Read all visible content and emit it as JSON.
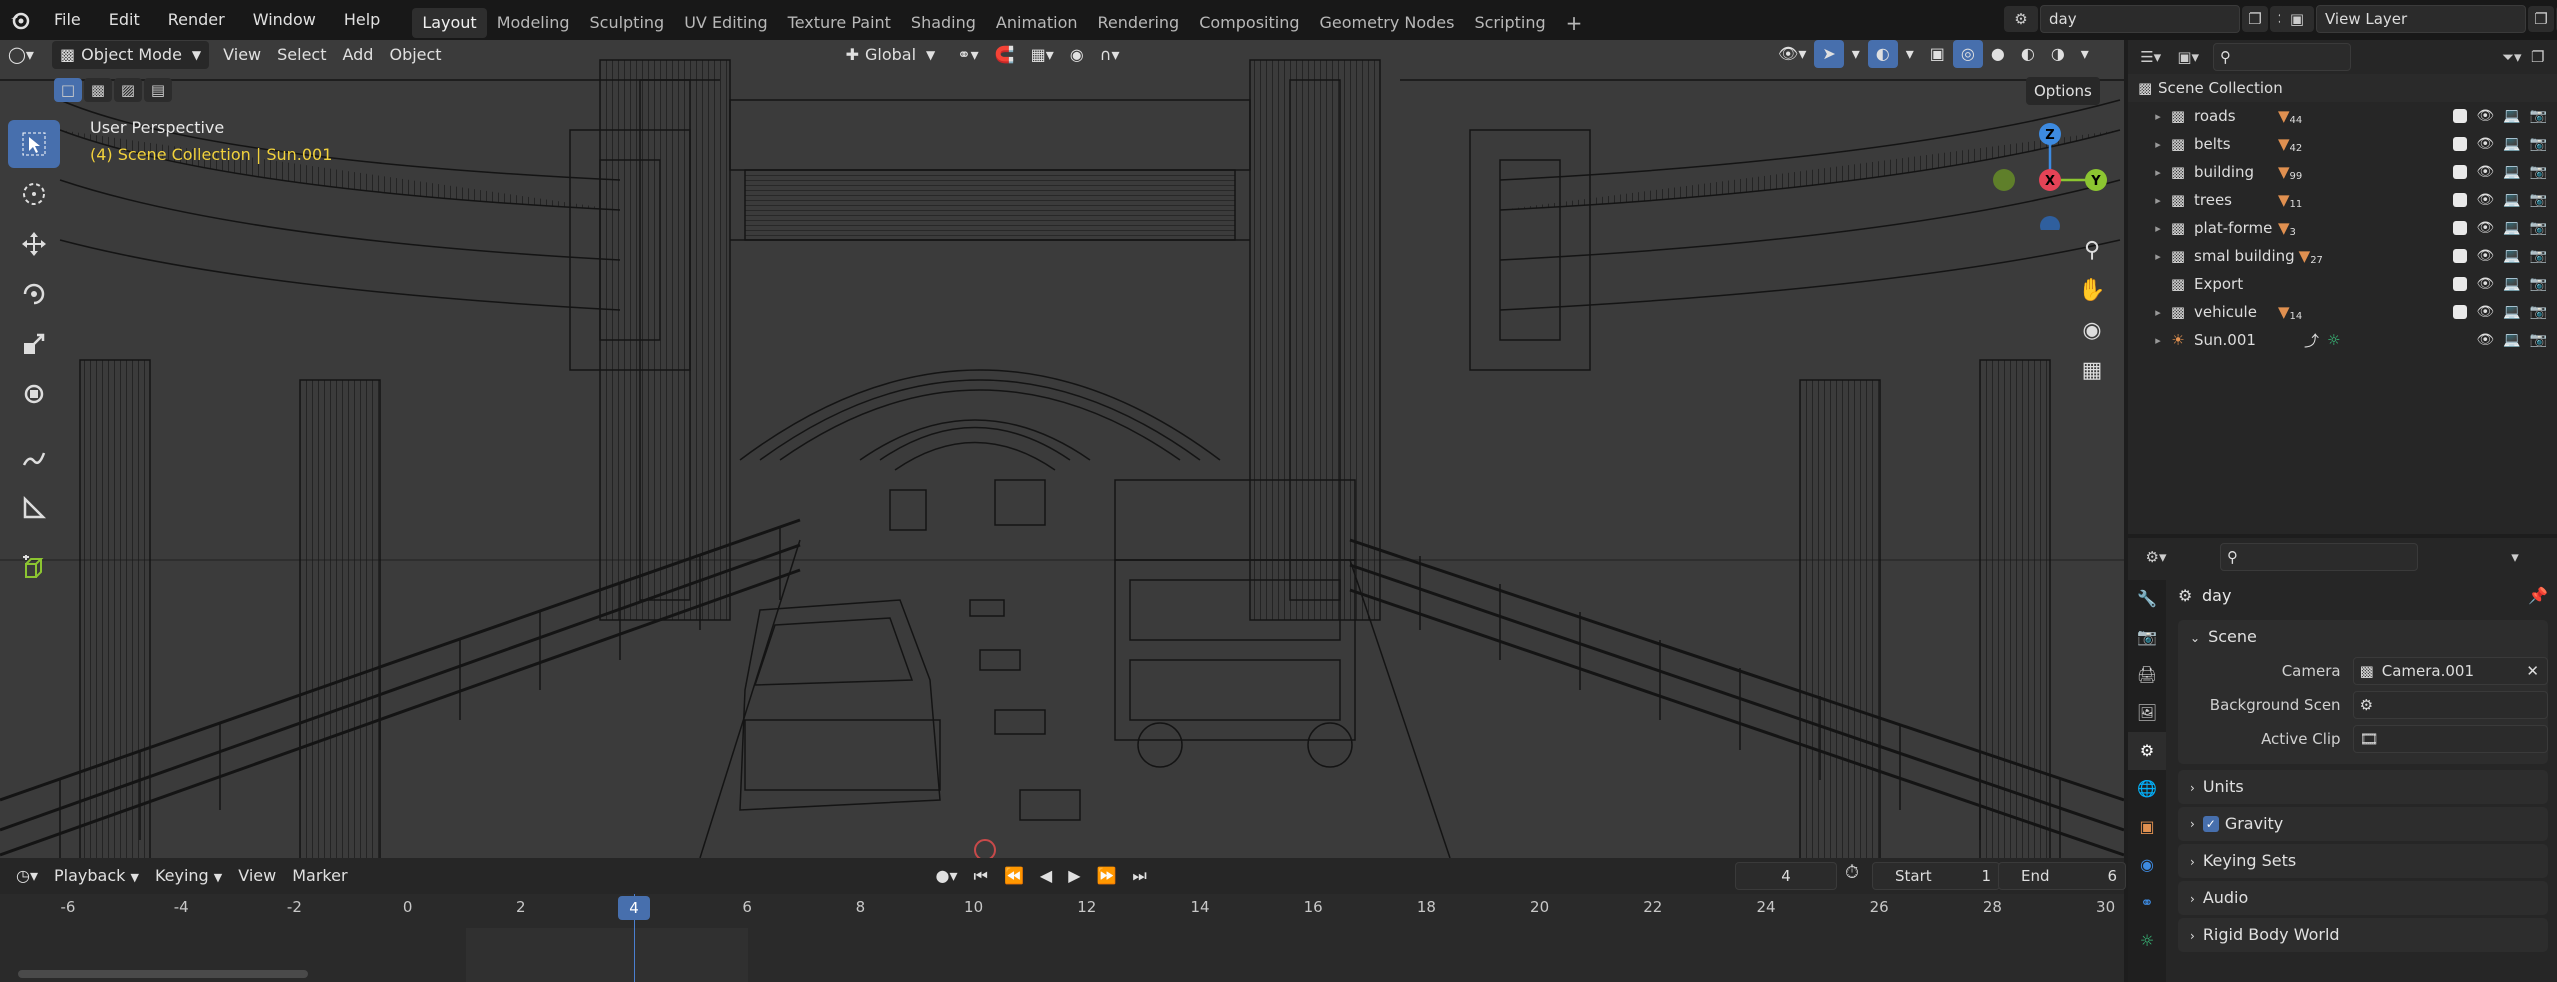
{
  "menubar": {
    "items": [
      "File",
      "Edit",
      "Render",
      "Window",
      "Help"
    ],
    "workspaces": [
      "Layout",
      "Modeling",
      "Sculpting",
      "UV Editing",
      "Texture Paint",
      "Shading",
      "Animation",
      "Rendering",
      "Compositing",
      "Geometry Nodes",
      "Scripting"
    ],
    "add_tab": "+",
    "scene_name": "day",
    "view_layer": "View Layer"
  },
  "viewport": {
    "mode": "Object Mode",
    "menus": [
      "View",
      "Select",
      "Add",
      "Object"
    ],
    "transform_orientation": "Global",
    "options_label": "Options",
    "overlay_title": "User Perspective",
    "overlay_subtitle": "(4) Scene Collection | Sun.001",
    "gizmo": {
      "z": "Z",
      "x": "X",
      "y": "Y"
    }
  },
  "outliner": {
    "root": "Scene Collection",
    "rows": [
      {
        "name": "roads",
        "count": "44"
      },
      {
        "name": "belts",
        "count": "42"
      },
      {
        "name": "building",
        "count": "99"
      },
      {
        "name": "trees",
        "count": "11"
      },
      {
        "name": "plat-forme",
        "count": "3"
      },
      {
        "name": "smal building",
        "count": "27"
      },
      {
        "name": "Export",
        "count": ""
      },
      {
        "name": "vehicule",
        "count": "14"
      },
      {
        "name": "Sun.001",
        "count": ""
      }
    ]
  },
  "properties": {
    "context_name": "day",
    "scene_panel": "Scene",
    "camera_label": "Camera",
    "camera_value": "Camera.001",
    "background_label": "Background Scen",
    "active_clip_label": "Active Clip",
    "panels": [
      "Units",
      "Gravity",
      "Keying Sets",
      "Audio",
      "Rigid Body World"
    ],
    "gravity_checked": true
  },
  "timeline": {
    "menus": [
      "Playback",
      "Keying",
      "View",
      "Marker"
    ],
    "current_frame": "4",
    "start_label": "Start",
    "start_value": "1",
    "end_label": "End",
    "end_value": "6",
    "ticks": [
      "-6",
      "-4",
      "-2",
      "0",
      "2",
      "4",
      "6",
      "8",
      "10",
      "12",
      "14",
      "16",
      "18",
      "20",
      "22",
      "24",
      "26",
      "28",
      "30"
    ]
  },
  "colors": {
    "accent": "#476fad",
    "orange": "#e09050",
    "overlay_yellow": "#f2d23c",
    "axis_x": "#e44356",
    "axis_y": "#8cc531",
    "axis_z": "#3d8ae0"
  }
}
